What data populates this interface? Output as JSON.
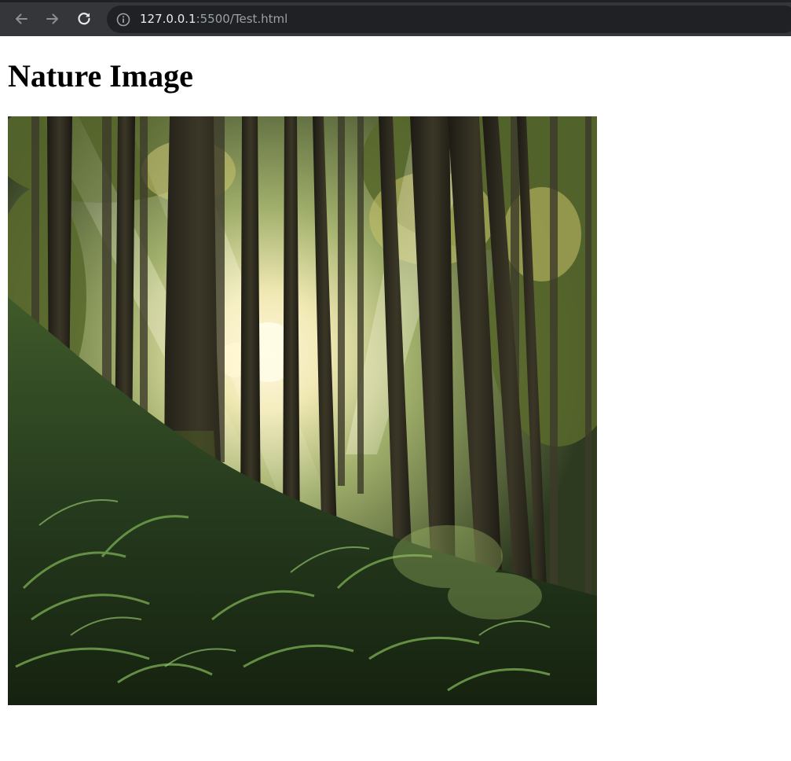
{
  "browser": {
    "url_host": "127.0.0.1",
    "url_rest": ":5500/Test.html",
    "back_icon": "arrow-left-icon",
    "forward_icon": "arrow-right-icon",
    "reload_icon": "reload-icon",
    "site_info_icon": "info-icon",
    "colors": {
      "toolbar": "#35363a",
      "omnibox": "#202124",
      "url_host": "#e8eaed",
      "url_rest": "#9aa0a6"
    }
  },
  "page": {
    "title": "Nature Image",
    "image_subject": "sunlit forest with tall trees and ferns"
  }
}
